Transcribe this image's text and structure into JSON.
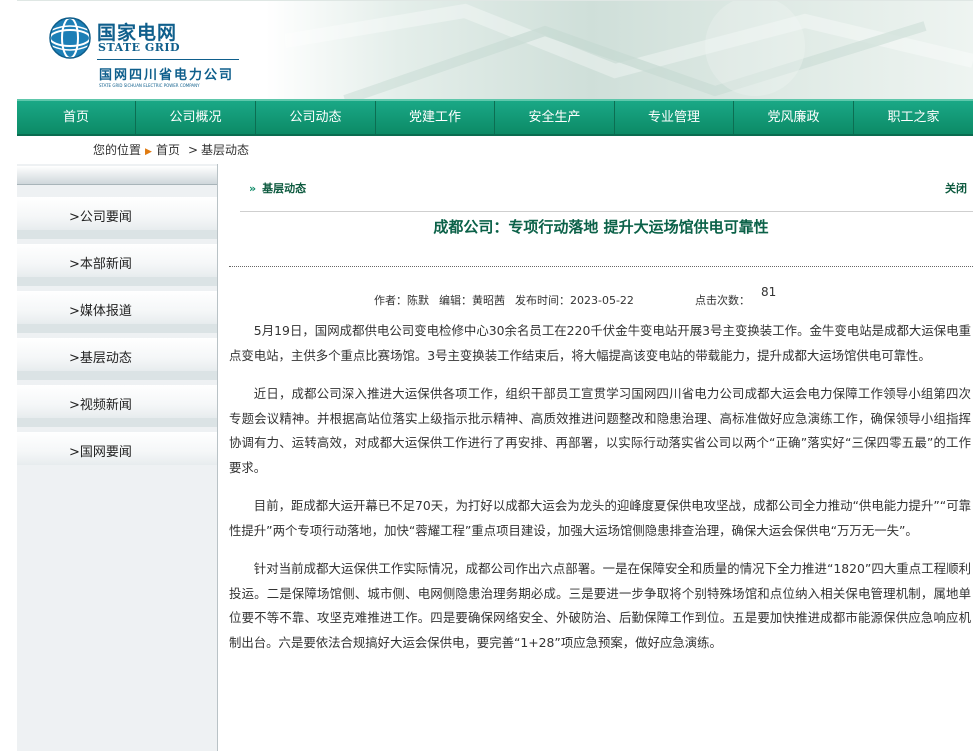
{
  "header": {
    "cn_name": "国家电网",
    "en_name": "STATE GRID",
    "prov_name": "国网四川省电力公司",
    "prov_en": "STATE GRID SICHUAN ELECTRIC POWER COMPANY"
  },
  "nav": [
    "首页",
    "公司概况",
    "公司动态",
    "党建工作",
    "安全生产",
    "专业管理",
    "党风廉政",
    "职工之家"
  ],
  "breadcrumb": {
    "position_label": "您的位置",
    "home": "首页",
    "current": "基层动态"
  },
  "sidebar": [
    "公司要闻",
    "本部新闻",
    "媒体报道",
    "基层动态",
    "视频新闻",
    "国网要闻"
  ],
  "sidebar_arrow": ">",
  "section": {
    "chevron": "»",
    "title": "基层动态",
    "close": "关闭"
  },
  "article": {
    "title": "成都公司：专项行动落地 提升大运场馆供电可靠性",
    "author": "作者：陈默",
    "editor": "编辑：黄昭茜",
    "published": "发布时间：2023-05-22",
    "clicks_label": "点击次数：",
    "clicks": "81",
    "paragraphs": [
      "5月19日，国网成都供电公司变电检修中心30余名员工在220千伏金牛变电站开展3号主变换装工作。金牛变电站是成都大运保电重点变电站，主供多个重点比赛场馆。3号主变换装工作结束后，将大幅提高该变电站的带载能力，提升成都大运场馆供电可靠性。",
      "近日，成都公司深入推进大运保供各项工作，组织干部员工宣贯学习国网四川省电力公司成都大运会电力保障工作领导小组第四次专题会议精神。并根据高站位落实上级指示批示精神、高质效推进问题整改和隐患治理、高标准做好应急演练工作，确保领导小组指挥协调有力、运转高效，对成都大运保供工作进行了再安排、再部署，以实际行动落实省公司以两个“正确”落实好“三保四零五最”的工作要求。",
      "目前，距成都大运开幕已不足70天，为打好以成都大运会为龙头的迎峰度夏保供电攻坚战，成都公司全力推动“供电能力提升”“可靠性提升”两个专项行动落地，加快“蓉耀工程”重点项目建设，加强大运场馆侧隐患排查治理，确保大运会保供电“万万无一失”。",
      "针对当前成都大运保供工作实际情况，成都公司作出六点部署。一是在保障安全和质量的情况下全力推进“1820”四大重点工程顺利投运。二是保障场馆侧、城市侧、电网侧隐患治理务期必成。三是要进一步争取将个别特殊场馆和点位纳入相关保电管理机制，属地单位要不等不靠、攻坚克难推进工作。四是要确保网络安全、外破防治、后勤保障工作到位。五是要加快推进成都市能源保供应急响应机制出台。六是要依法合规搞好大运会保供电，要完善“1+28”项应急预案，做好应急演练。"
    ]
  },
  "colors": {
    "nav_green": "#0c8a66",
    "brand_blue": "#0f5f8c",
    "title_green": "#0b6148",
    "crumb_arrow": "#e07a10"
  }
}
